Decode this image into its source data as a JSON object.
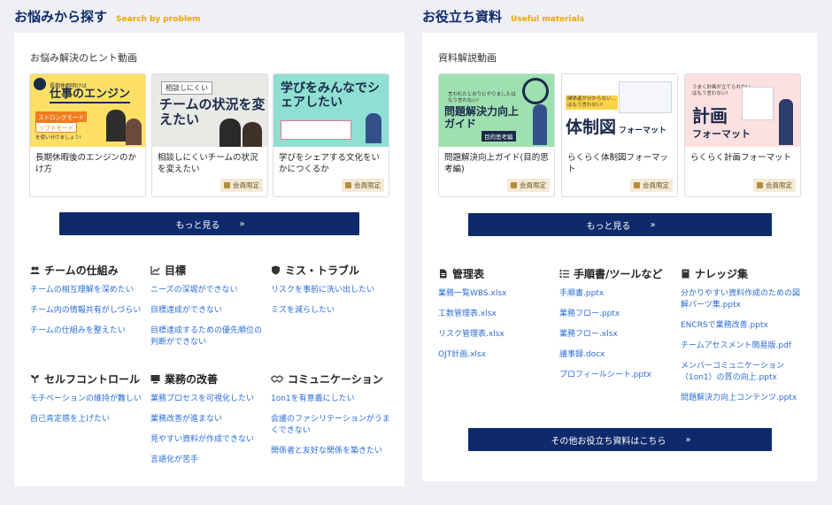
{
  "left": {
    "title": "お悩みから探す",
    "subtitle": "Search by problem",
    "panel_heading": "お悩み解決のヒント動画",
    "cards": [
      {
        "thumb_small": "長期休暇明けは",
        "thumb_main": "仕事のエンジン",
        "thumb_tag1": "ストロングモード",
        "thumb_tag2": "ソフトモード",
        "thumb_tail": "を使い分けましょう!",
        "title": "長期休暇後のエンジンのかけ方",
        "member": ""
      },
      {
        "thumb_small": "相談しにくい",
        "thumb_main": "チームの状況を変えたい",
        "thumb_tag1": "",
        "thumb_tag2": "",
        "thumb_tail": "",
        "title": "相談しにくいチームの状況を変えたい",
        "member": "会員限定"
      },
      {
        "thumb_small": "",
        "thumb_main": "学びをみんなでシェアしたい",
        "thumb_tag1": "",
        "thumb_tag2": "",
        "thumb_tail": "",
        "title": "学びをシェアする文化をいかにつくるか",
        "member": "会員限定"
      }
    ],
    "more_label": "もっと見る",
    "categories": [
      {
        "icon": "people-icon",
        "title": "チームの仕組み",
        "links": [
          "チームの相互理解を深めたい",
          "チーム内の情報共有がしづらい",
          "チームの仕組みを整えたい"
        ]
      },
      {
        "icon": "chart-icon",
        "title": "目標",
        "links": [
          "ニーズの深堀ができない",
          "目標達成ができない",
          "目標達成するための優先順位の判断ができない"
        ]
      },
      {
        "icon": "shield-icon",
        "title": "ミス・トラブル",
        "links": [
          "リスクを事前に洗い出したい",
          "ミスを減らしたい"
        ]
      },
      {
        "icon": "plant-icon",
        "title": "セルフコントロール",
        "links": [
          "モチベーションの維持が難しい",
          "自己肯定感を上げたい"
        ]
      },
      {
        "icon": "monitor-icon",
        "title": "業務の改善",
        "links": [
          "業務プロセスを可視化したい",
          "業務改善が進まない",
          "見やすい資料が作成できない",
          "言語化が苦手"
        ]
      },
      {
        "icon": "handshake-icon",
        "title": "コミュニケーション",
        "links": [
          "1on1を有意義にしたい",
          "会議のファシリテーションがうまくできない",
          "関係者と友好な関係を築きたい"
        ]
      }
    ]
  },
  "right": {
    "title": "お役立ち資料",
    "subtitle": "Useful materials",
    "panel_heading": "資料解説動画",
    "cards": [
      {
        "thumb_small": "言われたとおりにやりましたは\nもう言わない!",
        "thumb_main": "問題解決力向上ガイド",
        "thumb_tag1": "目的思考編",
        "title": "問題解決向上ガイド(目的思考編)",
        "member": "会員限定"
      },
      {
        "thumb_small": "関係者が分からない…\nはもう言わない!",
        "thumb_main": "体制図",
        "thumb_tag1": "フォーマット",
        "title": "らくらく体制図フォーマット",
        "member": "会員限定"
      },
      {
        "thumb_small": "うまく計画が立てられない…\nはもう言わない!",
        "thumb_main": "計画",
        "thumb_tag1": "フォーマット",
        "title": "らくらく計画フォーマット",
        "member": "会員限定"
      }
    ],
    "more_label": "もっと見る",
    "categories": [
      {
        "icon": "document-icon",
        "title": "管理表",
        "links": [
          "業務一覧WBS.xlsx",
          "工数管理表.xlsx",
          "リスク管理表.xlsx",
          "OJT計画.xlsx"
        ]
      },
      {
        "icon": "list-icon",
        "title": "手順書/ツールなど",
        "links": [
          "手順書.pptx",
          "業務フロー.pptx",
          "業務フロー.xlsx",
          "議事録.docx",
          "プロフィールシート.pptx"
        ]
      },
      {
        "icon": "book-icon",
        "title": "ナレッジ集",
        "links": [
          "分かりやすい資料作成のための図解パーツ集.pptx",
          "ENCRSで業務改善.pptx",
          "チームアセスメント簡易版.pdf",
          "メンバーコミュニケーション（1on1）の質の向上.pptx",
          "問題解決力向上コンテンツ.pptx"
        ]
      }
    ],
    "other_label": "その他お役立ち資料はこちら"
  }
}
